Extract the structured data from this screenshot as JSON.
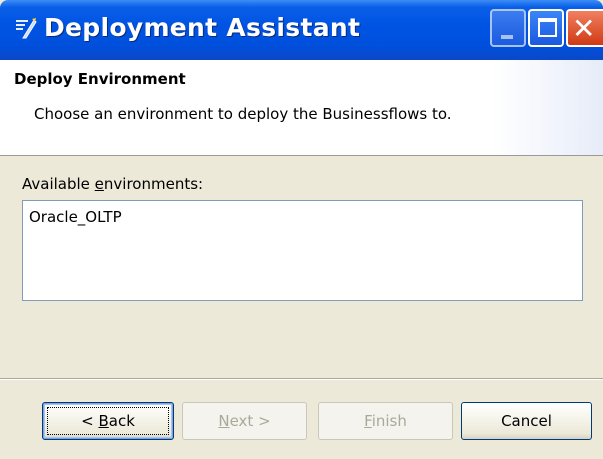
{
  "window": {
    "title": "Deployment Assistant",
    "icon": "deploy-wizard-icon"
  },
  "header": {
    "title": "Deploy Environment",
    "description": "Choose an environment to deploy the Businessflows to."
  },
  "environments": {
    "label": "Available environments:",
    "items": [
      "Oracle_OLTP"
    ]
  },
  "buttons": {
    "back": "< Back",
    "next": "Next >",
    "finish": "Finish",
    "cancel": "Cancel"
  },
  "colors": {
    "titlebar": "#0054e3",
    "close": "#d03a14",
    "dialog_bg": "#ece9d8"
  }
}
